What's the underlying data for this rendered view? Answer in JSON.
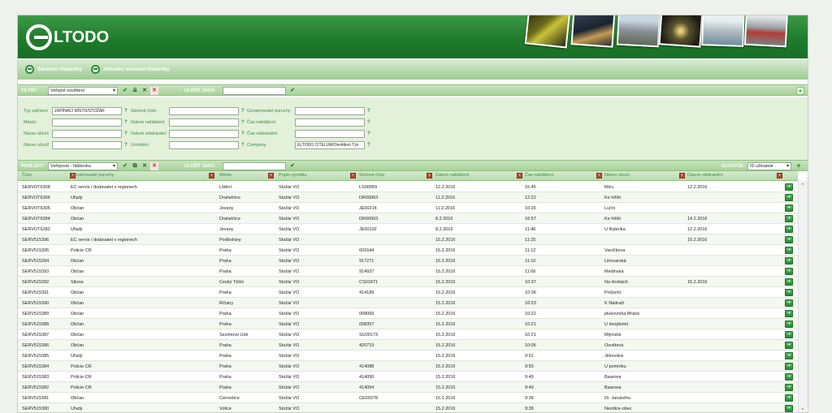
{
  "header": {
    "logo_text": "LTODO",
    "photos": [
      "tunnel-night-photo",
      "city-night-photo",
      "street-crossing-photo",
      "tunnel-photo",
      "traffic-photo",
      "control-room-photo"
    ]
  },
  "nav": {
    "items": [
      {
        "label": "Servisní hlášenky"
      },
      {
        "label": "Aktuální servisní hlášenky"
      }
    ]
  },
  "filters_bar": {
    "label": "FILTRY:",
    "selected": "Veřejné osvětlení",
    "save_as_label": "ULOŽIT JAKO:"
  },
  "filter_form": {
    "col1": [
      {
        "label": "Typ zařízení",
        "value": "ZAPÍNACÍ MÍSTO/STOŽÁR"
      },
      {
        "label": "Město:",
        "value": ""
      },
      {
        "label": "Název ulice1",
        "value": ""
      },
      {
        "label": "Název ulice2",
        "value": ""
      }
    ],
    "col2": [
      {
        "label": "Sériové číslo",
        "value": ""
      },
      {
        "label": "Datum nahlášení",
        "value": ""
      },
      {
        "label": "Datum odstranění",
        "value": ""
      },
      {
        "label": "Umístění",
        "value": ""
      }
    ],
    "col3": [
      {
        "label": "Oznamovatel poruchy",
        "value": ""
      },
      {
        "label": "Čas nahlášení",
        "value": ""
      },
      {
        "label": "Čas odstranění",
        "value": ""
      },
      {
        "label": "Company",
        "value": "ELTODO CITELUM/Osvětlení Týn"
      }
    ],
    "help": "?"
  },
  "views_bar": {
    "label": "POHLEDY:",
    "selected": "Veřejnost - hlášenka",
    "save_as_label": "ULOŽIT JAKO:",
    "columns_label": "SLOUPCE:",
    "columns_selected": "ID uživatele"
  },
  "table": {
    "columns": [
      "Číslo",
      "Oznamovatel poruchy",
      "Město",
      "Popis výrobku",
      "Sériové číslo",
      "Datum nahlášení",
      "Čas nahlášení",
      "Název ulice1",
      "Datum odstranění"
    ],
    "rows": [
      [
        "SERVOT6308",
        "EC servis / dodavatel v regionech",
        "Lštění",
        "Stožár VO",
        "LS00059",
        "12.2.2016",
        "15:45",
        "Míru",
        "12.2.2016"
      ],
      [
        "SERVOT6306",
        "Úřady",
        "Drahelčice",
        "Stožár VO",
        "DR00063",
        "11.2.2016",
        "12:22",
        "Ke hřišti",
        ""
      ],
      [
        "SERVOT6305",
        "Občan",
        "Jevany",
        "Stožár VO",
        "JE00214",
        "11.2.2016",
        "10:26",
        "Luční",
        ""
      ],
      [
        "SERVOT6284",
        "Občan",
        "Drahelčice",
        "Stožár VO",
        "DR00063",
        "8.2.2016",
        "16:57",
        "Ke hřišti",
        "14.2.2016"
      ],
      [
        "SERVOT6282",
        "Úřady",
        "Jevany",
        "Stožár VO",
        "JE00192",
        "8.2.2016",
        "11:46",
        "U Rybníka",
        "12.2.2016"
      ],
      [
        "SERV515396",
        "EC servis / dodavatel v regionech",
        "Podbořany",
        "Stožár VO",
        "",
        "15.2.2016",
        "11:25",
        "",
        "15.2.2016"
      ],
      [
        "SERV515395",
        "Policie ČR",
        "Praha",
        "Stožár VO",
        "601644",
        "15.2.2016",
        "11:12",
        "Vaníčkova",
        ""
      ],
      [
        "SERV515394",
        "Občan",
        "Praha",
        "Stožár VO",
        "917271",
        "15.2.2016",
        "11:10",
        "Lihovarská",
        ""
      ],
      [
        "SERV515393",
        "Občan",
        "Praha",
        "Stožár VO",
        "914937",
        "15.2.2016",
        "11:06",
        "Medinská",
        ""
      ],
      [
        "SERV515392",
        "Sikora",
        "Český Těšín",
        "Stožár VO",
        "CS01871",
        "15.2.2016",
        "10:37",
        "Na Horkách",
        "15.2.2016"
      ],
      [
        "SERV515391",
        "Občan",
        "Praha",
        "Stožár VO",
        "414189",
        "15.2.2016",
        "10:36",
        "Průčelní",
        ""
      ],
      [
        "SERV515390",
        "Občan",
        "Říčany",
        "Stožár VO",
        "",
        "15.2.2016",
        "10:23",
        "K Nádraží",
        ""
      ],
      [
        "SERV515389",
        "Občan",
        "Praha",
        "Stožár VO",
        "008069",
        "15.2.2016",
        "10:22",
        "plukovníka Mráze",
        ""
      ],
      [
        "SERV515388",
        "Občan",
        "Praha",
        "Stožár VO",
        "008357",
        "15.2.2016",
        "10:21",
        "U dvojdomů",
        ""
      ],
      [
        "SERV515387",
        "Občan",
        "Sezimovo Ústí",
        "Stožár VO",
        "SU00173",
        "15.2.2016",
        "10:21",
        "Mlýnská",
        ""
      ],
      [
        "SERV515386",
        "Občan",
        "Praha",
        "Stožár VO",
        "420715",
        "15.2.2016",
        "10:06",
        "Osvětová",
        ""
      ],
      [
        "SERV515385",
        "Úřady",
        "Praha",
        "Stožár VO",
        "",
        "15.2.2016",
        "9:51",
        "Jirkovská",
        ""
      ],
      [
        "SERV515384",
        "Policie ČR",
        "Praha",
        "Stožár VO",
        "414088",
        "15.2.2016",
        "9:50",
        "U pomníku",
        ""
      ],
      [
        "SERV515383",
        "Policie ČR",
        "Praha",
        "Stožár VO",
        "414050",
        "15.2.2016",
        "9:49",
        "Baarova",
        ""
      ],
      [
        "SERV515382",
        "Policie ČR",
        "Praha",
        "Stožár VO",
        "414054",
        "15.2.2016",
        "9:49",
        "Baarova",
        ""
      ],
      [
        "SERV515381",
        "Občan",
        "Černošice",
        "Stožár VO",
        "CE00378",
        "15.2.2016",
        "9:39",
        "Dr. Janského",
        ""
      ],
      [
        "SERV515380",
        "Úřady",
        "Votice",
        "Stožár VO",
        "",
        "15.2.2016",
        "9:39",
        "Nezdice-obec",
        ""
      ]
    ]
  },
  "icons": {
    "accent": "#2d8a38",
    "danger": "#d12a1e"
  }
}
